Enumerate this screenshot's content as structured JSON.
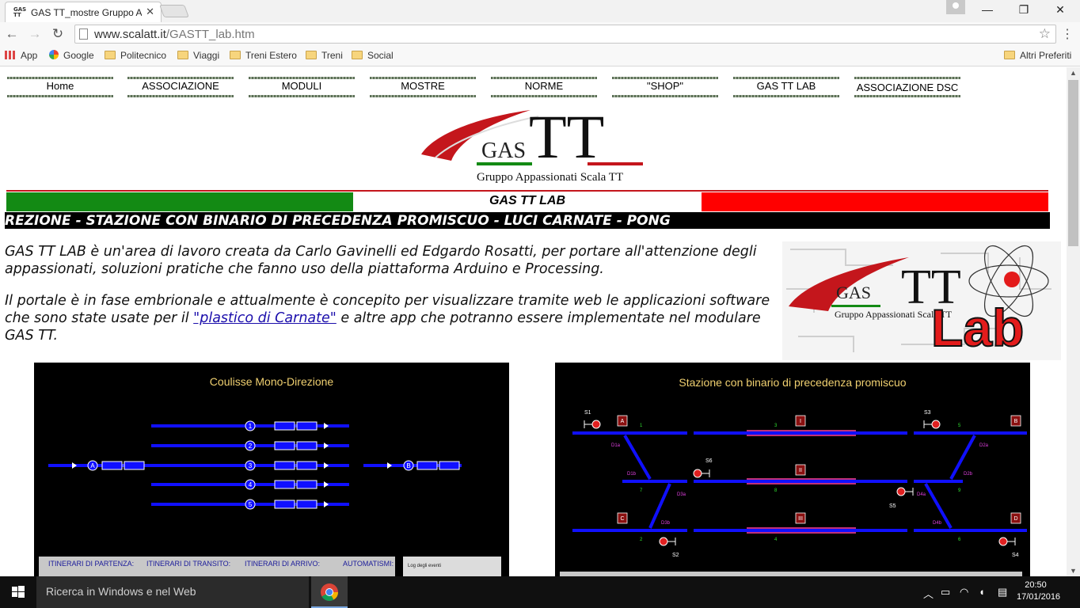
{
  "browser": {
    "tab_title": "GAS TT_mostre Gruppo Ap",
    "tab_favicon_text": "GAS TT",
    "url_host": "www.scalatt.it",
    "url_path": "/GASTT_lab.htm",
    "bookmarks": [
      "App",
      "Google",
      "Politecnico",
      "Viaggi",
      "Treni Estero",
      "Treni",
      "Social"
    ],
    "other_bookmarks": "Altri Preferiti"
  },
  "site": {
    "nav": [
      "Home",
      "ASSOCIAZIONE",
      "MODULI",
      "MOSTRE",
      "NORME",
      "\"SHOP\"",
      "GAS TT LAB",
      "ASSOCIAZIONE DSC"
    ],
    "logo": {
      "gas": "GAS",
      "tt": "TT",
      "subtitle": "Gruppo Appassionati Scala TT"
    },
    "lab_title": "GAS TT LAB",
    "ticker": "REZIONE - STAZIONE CON BINARIO DI PRECEDENZA PROMISCUO - LUCI CARNATE - PONG",
    "para1": "GAS TT LAB è un'area di lavoro creata da Carlo Gavinelli ed Edgardo Rosatti, per portare all'attenzione degli appassionati, soluzioni pratiche che fanno uso della piattaforma Arduino e Processing.",
    "para2_before": "Il portale è in fase embrionale e attualmente è concepito per visualizzare tramite web le applicazioni software che sono state usate per il ",
    "para2_link": "\"plastico di Carnate\"",
    "para2_after": " e altre app che potranno essere implementate nel modulare GAS TT.",
    "lab_logo": {
      "gas": "GAS",
      "tt": "TT",
      "lab": "Lab",
      "subtitle": "Gruppo Appassionati Scala TT"
    },
    "panel1": {
      "title": "Coulisse Mono-Direzione",
      "track_numbers": [
        "1",
        "2",
        "3",
        "4",
        "5"
      ],
      "point_a": "A",
      "point_b": "B",
      "footer": [
        "ITINERARI DI PARTENZA:",
        "ITINERARI DI TRANSITO:",
        "ITINERARI DI ARRIVO:",
        "AUTOMATISMI:"
      ],
      "log": "Log degli eventi"
    },
    "panel2": {
      "title": "Stazione con binario di precedenza promiscuo",
      "signals": [
        "S1",
        "S3",
        "S6",
        "S5",
        "S2",
        "S4"
      ],
      "markers": [
        "A",
        "B",
        "C",
        "D"
      ],
      "platforms": [
        "I",
        "II",
        "III"
      ],
      "switches": [
        "D1a",
        "D1b",
        "D3a",
        "D3b",
        "D2a",
        "D2b",
        "D4a",
        "D4b"
      ],
      "track_labels": [
        "1",
        "3",
        "5",
        "7",
        "8",
        "9",
        "2",
        "4",
        "6"
      ]
    }
  },
  "taskbar": {
    "search_placeholder": "Ricerca in Windows e nel Web",
    "time": "20:50",
    "date": "17/01/2016"
  },
  "colors": {
    "green": "#138a14",
    "red": "#ff0000",
    "track_blue": "#1010ff"
  }
}
